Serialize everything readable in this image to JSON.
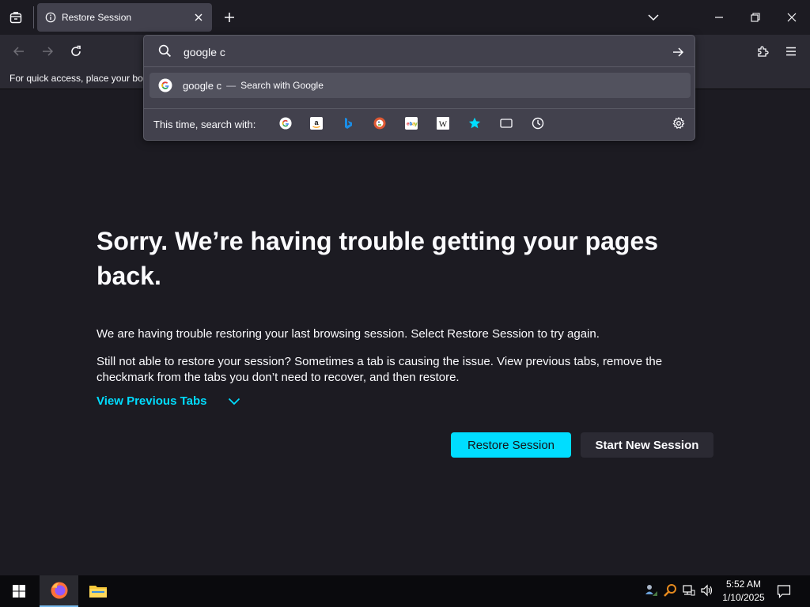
{
  "tab": {
    "title": "Restore Session"
  },
  "urlbar": {
    "value": "google c"
  },
  "suggestion": {
    "text": "google c",
    "separator": "—",
    "description": "Search with Google"
  },
  "oneoff": {
    "label": "This time, search with:",
    "engines": [
      "google-icon",
      "amazon-icon",
      "bing-icon",
      "duckduckgo-icon",
      "ebay-icon",
      "wikipedia-icon",
      "bookmarks-star-icon",
      "tabs-icon",
      "history-icon"
    ]
  },
  "bookmarks_bar": {
    "text": "For quick access, place your boo"
  },
  "page": {
    "title": "Sorry. We’re having trouble getting your pages back.",
    "para1": "We are having trouble restoring your last browsing session. Select Restore Session to try again.",
    "para2": "Still not able to restore your session? Sometimes a tab is causing the issue. View previous tabs, remove the checkmark from the tabs you don’t need to recover, and then restore.",
    "view_previous": "View Previous Tabs",
    "restore_label": "Restore Session",
    "new_session_label": "Start New Session"
  },
  "taskbar": {
    "time": "5:52 AM",
    "date": "1/10/2025"
  },
  "colors": {
    "accent": "#00ddff",
    "background": "#1c1b22",
    "toolbar": "#2b2a33",
    "popup": "#42414d"
  }
}
